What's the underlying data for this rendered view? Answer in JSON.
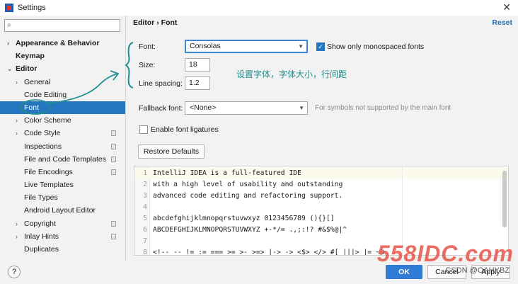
{
  "window": {
    "title": "Settings"
  },
  "sidebar": {
    "search_placeholder": "",
    "items": [
      {
        "label": "Appearance & Behavior",
        "bold": true,
        "level": 0,
        "chevron": "›"
      },
      {
        "label": "Keymap",
        "bold": true,
        "level": 0,
        "chevron": ""
      },
      {
        "label": "Editor",
        "bold": true,
        "level": 0,
        "chevron": "⌄"
      },
      {
        "label": "General",
        "level": 1,
        "chevron": "›"
      },
      {
        "label": "Code Editing",
        "level": 1,
        "chevron": ""
      },
      {
        "label": "Font",
        "level": 1,
        "chevron": "",
        "selected": true
      },
      {
        "label": "Color Scheme",
        "level": 1,
        "chevron": "›"
      },
      {
        "label": "Code Style",
        "level": 1,
        "chevron": "›",
        "copy": true
      },
      {
        "label": "Inspections",
        "level": 1,
        "chevron": "",
        "copy": true
      },
      {
        "label": "File and Code Templates",
        "level": 1,
        "chevron": "",
        "copy": true
      },
      {
        "label": "File Encodings",
        "level": 1,
        "chevron": "",
        "copy": true
      },
      {
        "label": "Live Templates",
        "level": 1,
        "chevron": ""
      },
      {
        "label": "File Types",
        "level": 1,
        "chevron": ""
      },
      {
        "label": "Android Layout Editor",
        "level": 1,
        "chevron": ""
      },
      {
        "label": "Copyright",
        "level": 1,
        "chevron": "›",
        "copy": true
      },
      {
        "label": "Inlay Hints",
        "level": 1,
        "chevron": "›",
        "copy": true
      },
      {
        "label": "Duplicates",
        "level": 1,
        "chevron": ""
      }
    ]
  },
  "header": {
    "breadcrumb": "Editor  ›  Font",
    "reset": "Reset"
  },
  "font_settings": {
    "font_label": "Font:",
    "font_value": "Consolas",
    "mono_label": "Show only monospaced fonts",
    "mono_checked": true,
    "size_label": "Size:",
    "size_value": "18",
    "spacing_label": "Line spacing:",
    "spacing_value": "1.2",
    "annotation": "设置字体，字体大小，行间距",
    "fallback_label": "Fallback font:",
    "fallback_value": "<None>",
    "fallback_hint": "For symbols not supported by the main font",
    "ligatures_label": "Enable font ligatures",
    "ligatures_checked": false,
    "restore_label": "Restore Defaults"
  },
  "preview": {
    "lines": [
      {
        "n": "1",
        "text": "IntelliJ IDEA is a full-featured IDE"
      },
      {
        "n": "2",
        "text": "with a high level of usability and outstanding"
      },
      {
        "n": "3",
        "text": "advanced code editing and refactoring support."
      },
      {
        "n": "4",
        "text": ""
      },
      {
        "n": "5",
        "text": "abcdefghijklmnopqrstuvwxyz 0123456789 (){}[]"
      },
      {
        "n": "6",
        "text": "ABCDEFGHIJKLMNOPQRSTUVWXYZ +-*/= .,;:!? #&$%@|^"
      },
      {
        "n": "7",
        "text": ""
      },
      {
        "n": "8",
        "text": "<!-- -- != := === >= >- >=> |-> -> <$> </> #[ |||> |= ~@"
      }
    ]
  },
  "footer": {
    "help": "?",
    "ok": "OK",
    "cancel": "Cancel",
    "apply": "Apply"
  },
  "watermark": {
    "logo": "558IDC.com",
    "text": "CSDN @OAHYBZ"
  },
  "colors": {
    "accent": "#2675bf",
    "annotation": "#1f8f8f",
    "watermark": "#e85a4f"
  }
}
